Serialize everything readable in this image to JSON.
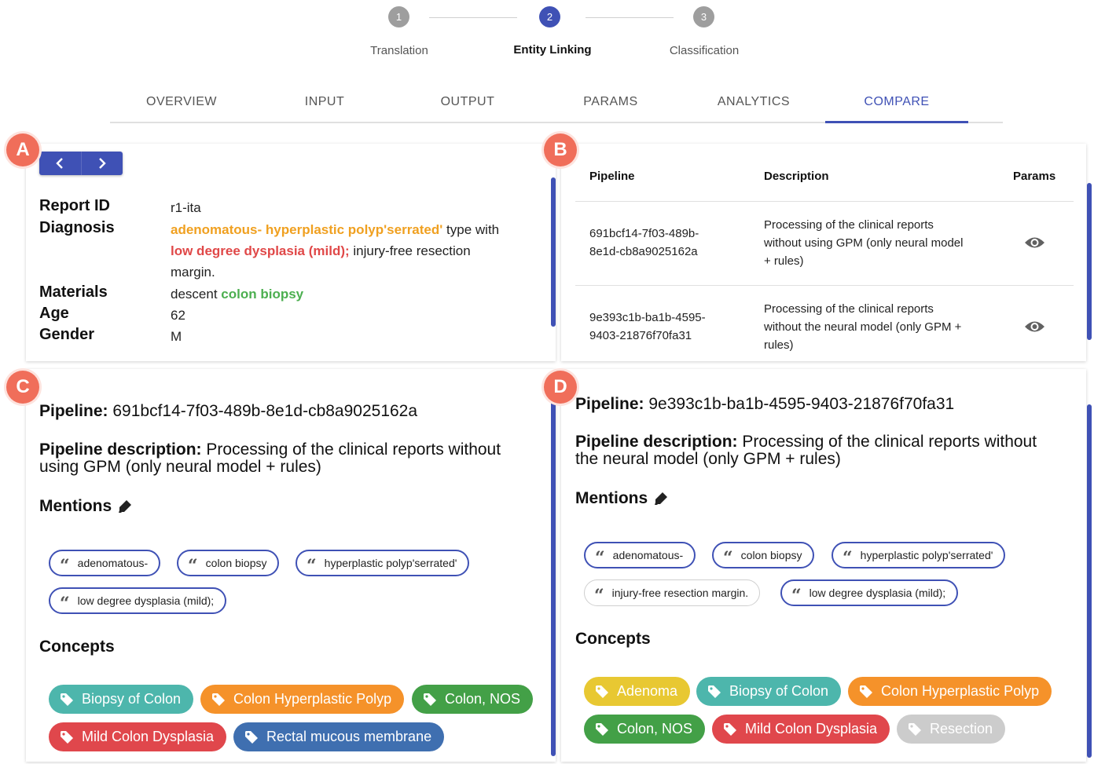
{
  "stepper": {
    "steps": [
      {
        "num": "1",
        "label": "Translation"
      },
      {
        "num": "2",
        "label": "Entity Linking"
      },
      {
        "num": "3",
        "label": "Classification"
      }
    ]
  },
  "tabs": [
    "OVERVIEW",
    "INPUT",
    "OUTPUT",
    "PARAMS",
    "ANALYTICS",
    "COMPARE"
  ],
  "badges": {
    "a": "A",
    "b": "B",
    "c": "C",
    "d": "D"
  },
  "report": {
    "report_id_label": "Report ID",
    "report_id": "r1-ita",
    "diagnosis_label": "Diagnosis",
    "diag_hl1": "adenomatous-",
    "diag_hl2": "hyperplastic polyp'serrated'",
    "diag_text1": "type with",
    "diag_hl3": "low degree dysplasia (mild);",
    "diag_text2": "injury-free resection",
    "diag_text3": "margin.",
    "materials_label": "Materials",
    "materials_text": "descent",
    "materials_hl": "colon biopsy",
    "age_label": "Age",
    "age": "62",
    "gender_label": "Gender",
    "gender": "M"
  },
  "pipelines_table": {
    "headers": {
      "pipeline": "Pipeline",
      "description": "Description",
      "params": "Params"
    },
    "rows": [
      {
        "id_l1": "691bcf14-7f03-489b-",
        "id_l2": "8e1d-cb8a9025162a",
        "d1": "Processing of the clinical reports",
        "d2": "without using GPM (only neural model",
        "d3": "+ rules)"
      },
      {
        "id_l1": "9e393c1b-ba1b-4595-",
        "id_l2": "9403-21876f70fa31",
        "d1": "Processing of the clinical reports",
        "d2": "without the neural model (only GPM +",
        "d3": "rules)"
      }
    ]
  },
  "left": {
    "pipeline_label": "Pipeline:",
    "pipeline_id": "691bcf14-7f03-489b-8e1d-cb8a9025162a",
    "desc_label": "Pipeline description:",
    "desc_l1": "Processing of the clinical reports without",
    "desc_l2": "using GPM (only neural model + rules)",
    "mentions_label": "Mentions",
    "mentions": [
      "adenomatous-",
      "colon biopsy",
      "hyperplastic polyp'serrated'",
      "low degree dysplasia (mild);"
    ],
    "concepts_label": "Concepts",
    "concepts": [
      "Biopsy of Colon",
      "Colon Hyperplastic Polyp",
      "Colon, NOS",
      "Mild Colon Dysplasia",
      "Rectal mucous membrane"
    ]
  },
  "right": {
    "pipeline_label": "Pipeline:",
    "pipeline_id": "9e393c1b-ba1b-4595-9403-21876f70fa31",
    "desc_label": "Pipeline description:",
    "desc_l1": "Processing of the clinical reports without",
    "desc_l2": "the neural model (only GPM + rules)",
    "mentions_label": "Mentions",
    "mentions": [
      "adenomatous-",
      "colon biopsy",
      "hyperplastic polyp'serrated'",
      "injury-free resection margin.",
      "low degree dysplasia (mild);"
    ],
    "concepts_label": "Concepts",
    "concepts": [
      "Adenoma",
      "Biopsy of Colon",
      "Colon Hyperplastic Polyp",
      "Colon, NOS",
      "Mild Colon Dysplasia",
      "Resection"
    ]
  },
  "colors": {
    "accent": "#3f51b5",
    "badge": "#f06e5a",
    "teal": "#4db6ac",
    "orange": "#f5922a",
    "green": "#43a047",
    "red": "#e0474c",
    "blue": "#3f6fb0",
    "yellow": "#e8c832",
    "grey": "#cccccc"
  },
  "icons": {
    "prev": "chevron-left-icon",
    "next": "chevron-right-icon",
    "view": "eye-icon",
    "mentions": "highlighter-icon",
    "quote": "quote-icon",
    "tag": "tag-icon"
  }
}
